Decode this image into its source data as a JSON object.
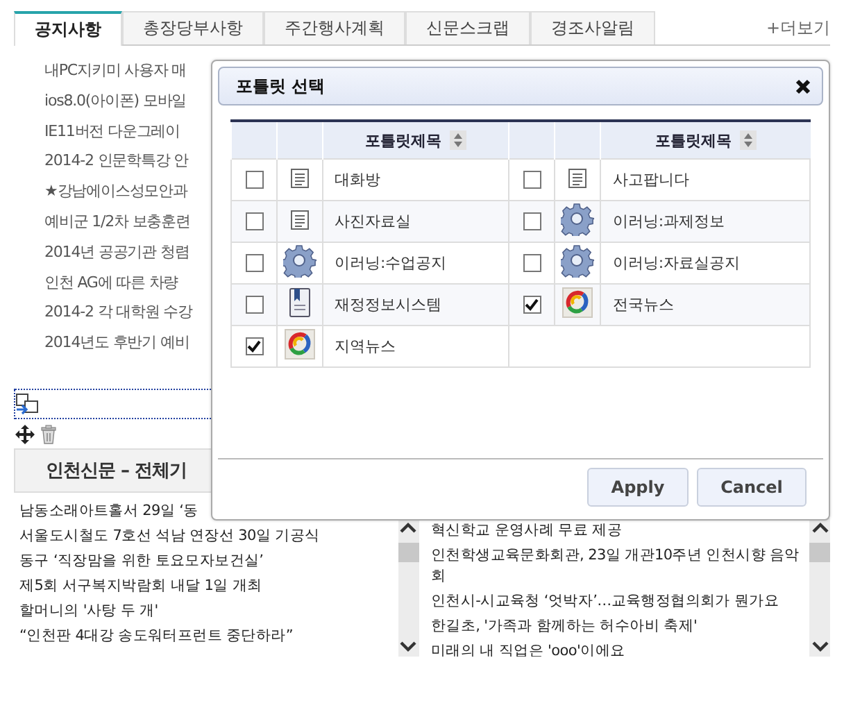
{
  "tabs": [
    {
      "label": "공지사항",
      "selected": true
    },
    {
      "label": "총장당부사항",
      "selected": false
    },
    {
      "label": "주간행사계획",
      "selected": false
    },
    {
      "label": "신문스크랩",
      "selected": false
    },
    {
      "label": "경조사알림",
      "selected": false
    }
  ],
  "more_link": "+더보기",
  "notices": [
    "내PC지키미 사용자 매",
    "ios8.0(아이폰) 모바일",
    "IE11버전 다운그레이",
    "2014-2 인문학특강 안",
    "★강남에이스성모안과",
    "예비군 1/2차 보충훈련",
    "2014년 공공기관 청렴",
    "인천 AG에 따른 차량",
    "2014-2 각 대학원 수강",
    "2014년도 후반기 예비"
  ],
  "section_title": "인천신문 – 전체기",
  "news_left": [
    "남동소래아트홀서 29일 ‘동",
    "서울도시철도 7호선 석남 연장선 30일 기공식",
    "동구 ‘직장맘을 위한 토요모자보건실’",
    "제5회 서구복지박람회 내달 1일 개최",
    "할머니의 '사탕 두 개'",
    "“인천판 4대강 송도워터프런트 중단하라”"
  ],
  "news_right": [
    "혁신학교 운영사례 무료 제공",
    "인천학생교육문화회관, 23일 개관10주년 인천시향 음악회",
    "인천시-시교육청 ‘엇박자’…교육행정협의회가 뭔가요",
    "한길초, '가족과 함께하는 허수아비 축제'",
    "미래의 내 직업은 'ooo'이에요"
  ],
  "dialog": {
    "title": "포틀릿 선택",
    "columns": [
      "포틀릿제목",
      "포틀릿제목"
    ],
    "items": [
      {
        "title": "대화방",
        "kind": "document",
        "checked": false
      },
      {
        "title": "사고팝니다",
        "kind": "document",
        "checked": false
      },
      {
        "title": "사진자료실",
        "kind": "document",
        "checked": false
      },
      {
        "title": "이러닝:과제정보",
        "kind": "gear",
        "checked": false
      },
      {
        "title": "이러닝:수업공지",
        "kind": "gear",
        "checked": false
      },
      {
        "title": "이러닝:자료실공지",
        "kind": "gear",
        "checked": false
      },
      {
        "title": "재정정보시스템",
        "kind": "book",
        "checked": false
      },
      {
        "title": "전국뉴스",
        "kind": "news",
        "checked": true
      },
      {
        "title": "지역뉴스",
        "kind": "news",
        "checked": true
      }
    ],
    "buttons": [
      "Apply",
      "Cancel"
    ]
  }
}
